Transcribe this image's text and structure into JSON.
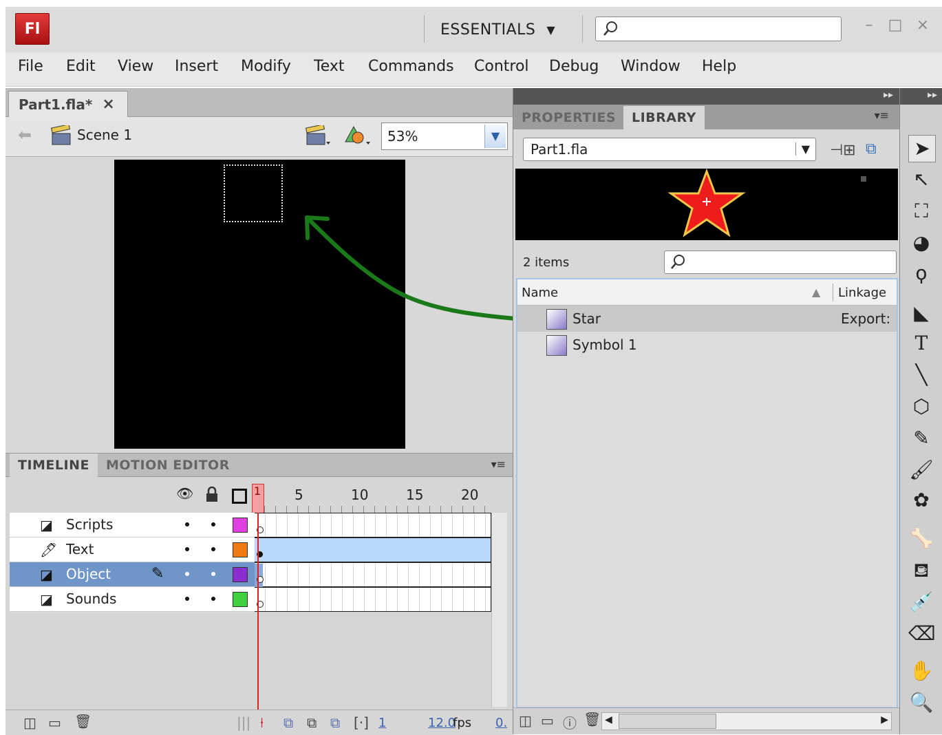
{
  "titlebar": {
    "logo": "Fl",
    "workspace": "ESSENTIALS",
    "search_placeholder": "",
    "window_buttons": [
      "minimize-icon",
      "maximize-icon",
      "close-icon"
    ]
  },
  "menu": [
    "File",
    "Edit",
    "View",
    "Insert",
    "Modify",
    "Text",
    "Commands",
    "Control",
    "Debug",
    "Window",
    "Help"
  ],
  "document": {
    "tab_label": "Part1.fla*",
    "close_glyph": "×",
    "scene_label": "Scene 1",
    "zoom": "53%"
  },
  "timeline": {
    "tabs": [
      "TIMELINE",
      "MOTION EDITOR"
    ],
    "frame_numbers": [
      "5",
      "10",
      "15",
      "20"
    ],
    "playhead_frame": "1",
    "layers": [
      {
        "name": "Scripts",
        "color": "#e040e0",
        "selected": false,
        "icon": "layer-icon"
      },
      {
        "name": "Text",
        "color": "#f07a10",
        "selected": false,
        "icon": "mask-layer-icon"
      },
      {
        "name": "Object",
        "color": "#8a2ed0",
        "selected": true,
        "icon": "layer-icon"
      },
      {
        "name": "Sounds",
        "color": "#40d040",
        "selected": false,
        "icon": "layer-icon"
      }
    ],
    "current_frame": "1",
    "fps": "12.0",
    "fps_unit": "fps",
    "elapsed": "0."
  },
  "panel": {
    "tabs": [
      "PROPERTIES",
      "LIBRARY"
    ],
    "library_select": "Part1.fla",
    "items_count": "2 items",
    "columns": {
      "name": "Name",
      "linkage": "Linkage"
    },
    "items": [
      {
        "name": "Star",
        "linkage": "Export: :",
        "selected": true
      },
      {
        "name": "Symbol 1",
        "linkage": "",
        "selected": false
      }
    ]
  },
  "colors": {
    "accent_selected": "#6f95c9",
    "arrow": "#1a7a1a",
    "star_fill": "#ee1c1c",
    "star_stroke": "#f2c84a"
  },
  "tools": [
    "selection-tool-icon",
    "subselection-tool-icon",
    "free-transform-tool-icon",
    "3d-rotation-tool-icon",
    "lasso-tool-icon",
    "pen-tool-icon",
    "text-tool-icon",
    "line-tool-icon",
    "polystar-tool-icon",
    "pencil-tool-icon",
    "brush-tool-icon",
    "deco-tool-icon",
    "bone-tool-icon",
    "paint-bucket-tool-icon",
    "eyedropper-tool-icon",
    "eraser-tool-icon",
    "hand-tool-icon",
    "zoom-tool-icon"
  ]
}
